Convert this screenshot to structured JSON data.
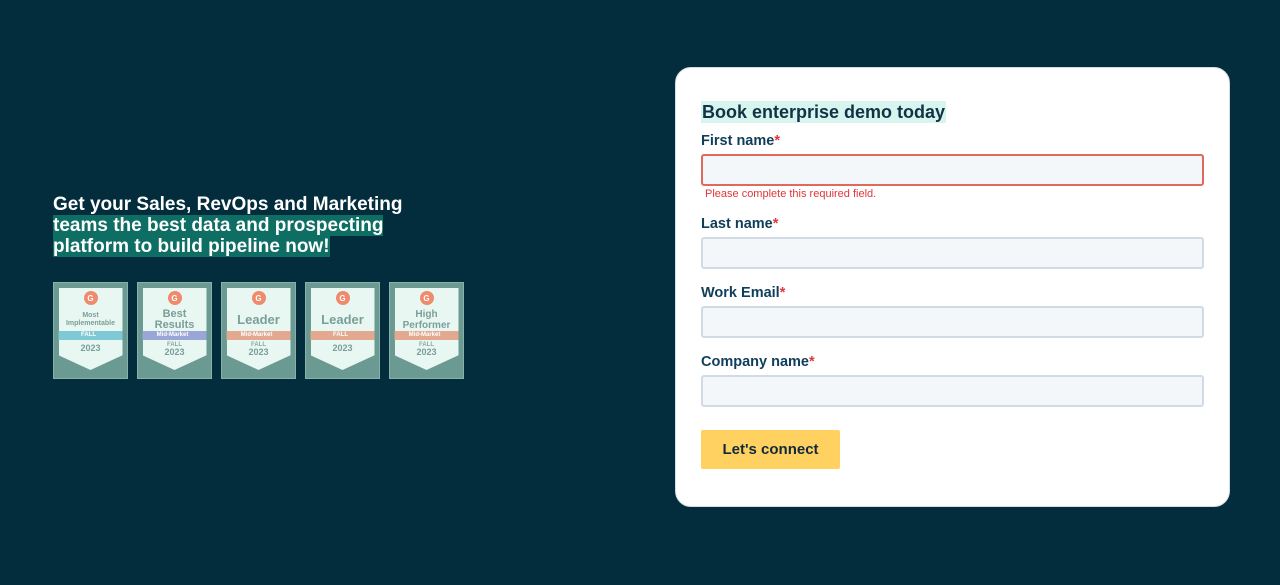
{
  "hero": {
    "line1": "Get your Sales, RevOps and Marketing",
    "line2": "teams the best data and prospecting",
    "line3": "platform to build pipeline now!"
  },
  "badges": [
    {
      "title": "Most Implementable",
      "ribbon": "FALL",
      "ribbon_color": "#7fc9d6",
      "season": "",
      "year": "2023"
    },
    {
      "title": "Best Results",
      "ribbon": "Mid-Market",
      "ribbon_color": "#9aa6d6",
      "season": "FALL",
      "year": "2023"
    },
    {
      "title": "Leader",
      "ribbon": "Mid-Market",
      "ribbon_color": "#e2a990",
      "season": "FALL",
      "year": "2023"
    },
    {
      "title": "Leader",
      "ribbon": "FALL",
      "ribbon_color": "#e2a990",
      "season": "",
      "year": "2023"
    },
    {
      "title": "High Performer",
      "ribbon": "Mid-Market",
      "ribbon_color": "#e2a990",
      "season": "FALL",
      "year": "2023"
    }
  ],
  "form": {
    "title": "Book enterprise demo today",
    "required_mark": "*",
    "fields": [
      {
        "label": "First name",
        "value": "",
        "error": "Please complete this required field."
      },
      {
        "label": "Last name",
        "value": ""
      },
      {
        "label": "Work Email",
        "value": ""
      },
      {
        "label": "Company name",
        "value": ""
      }
    ],
    "submit_label": "Let's connect"
  },
  "colors": {
    "background": "#032d3c",
    "highlight": "#0f6e63",
    "button": "#ffd161",
    "error": "#e0363b"
  }
}
